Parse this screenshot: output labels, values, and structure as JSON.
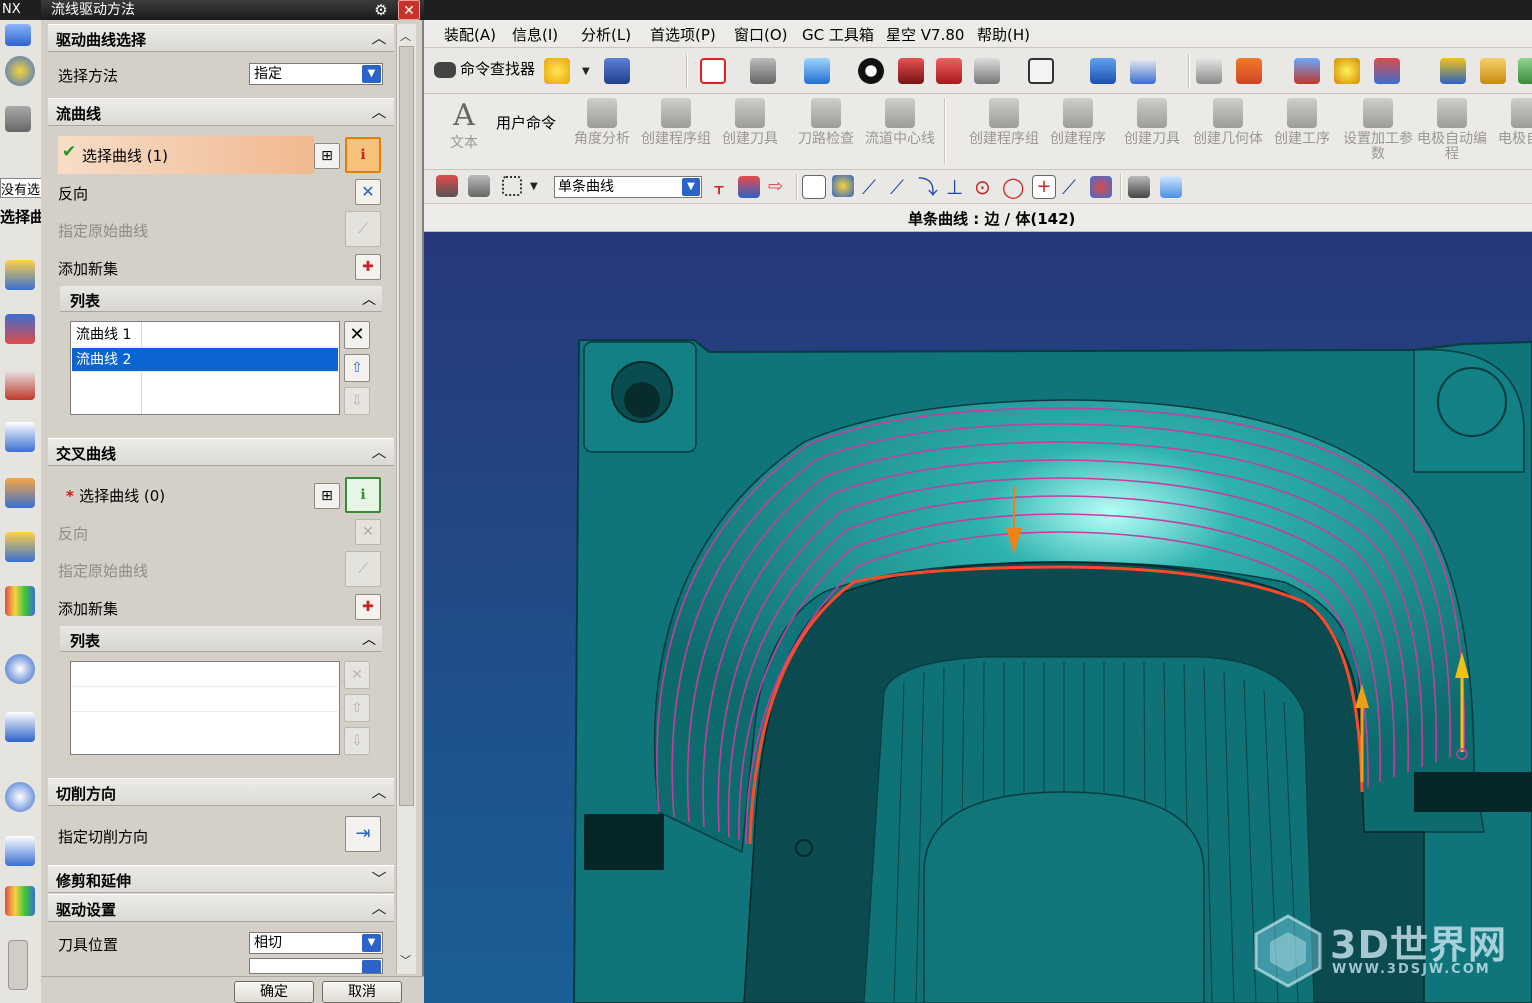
{
  "app": {
    "title_fragment": "NX"
  },
  "menu": [
    {
      "label": "装配(A)"
    },
    {
      "label": "信息(I)"
    },
    {
      "label": "分析(L)"
    },
    {
      "label": "首选项(P)"
    },
    {
      "label": "窗口(O)"
    },
    {
      "label": "GC 工具箱"
    },
    {
      "label": "星空 V7.80"
    },
    {
      "label": "帮助(H)"
    }
  ],
  "toolbar1": {
    "command_finder": "命令查找器"
  },
  "toolbar2": {
    "text_label": "文本",
    "user_cmd": "用户命令",
    "items": [
      {
        "label": "角度分析",
        "icon": "angle-analysis-icon"
      },
      {
        "label": "创建程序组",
        "icon": "create-program-group-icon"
      },
      {
        "label": "创建刀具",
        "icon": "create-tool-icon"
      },
      {
        "label": "刀路检查",
        "icon": "toolpath-check-icon"
      },
      {
        "label": "流道中心线",
        "icon": "runner-centerline-icon"
      },
      {
        "label": "创建程序组",
        "icon": "create-program-group-icon"
      },
      {
        "label": "创建程序",
        "icon": "create-program-icon"
      },
      {
        "label": "创建刀具",
        "icon": "create-tool-icon"
      },
      {
        "label": "创建几何体",
        "icon": "create-geometry-icon"
      },
      {
        "label": "创建工序",
        "icon": "create-operation-icon"
      },
      {
        "label": "设置加工参数",
        "icon": "set-machining-params-icon"
      },
      {
        "label": "电极自动编程",
        "icon": "electrode-auto-program-icon"
      },
      {
        "label": "电极自动",
        "icon": "electrode-auto-icon"
      }
    ]
  },
  "selection_bar": {
    "filter": "单条曲线"
  },
  "status": {
    "text": "单条曲线 : 边 / 体(142)"
  },
  "left_resource": {
    "frag1": "没有选",
    "frag2": "选择曲"
  },
  "dialog": {
    "title": "流线驱动方法",
    "sections": {
      "drive_select": "驱动曲线选择",
      "flow": "流曲线",
      "cross": "交叉曲线",
      "cut_dir": "切削方向",
      "trim": "修剪和延伸",
      "drive_settings": "驱动设置"
    },
    "select_method_label": "选择方法",
    "select_method_value": "指定",
    "flow": {
      "select_curve": "选择曲线 (1)",
      "reverse": "反向",
      "origin_curve": "指定原始曲线",
      "add_set": "添加新集",
      "list_title": "列表",
      "list": [
        "流曲线 1",
        "流曲线 2"
      ]
    },
    "cross": {
      "select_curve": "选择曲线 (0)",
      "reverse": "反向",
      "origin_curve": "指定原始曲线",
      "add_set": "添加新集",
      "list_title": "列表"
    },
    "cut_dir_label": "指定切削方向",
    "tool_pos_label": "刀具位置",
    "tool_pos_value": "相切",
    "ok": "确定",
    "cancel": "取消"
  },
  "watermark": {
    "big": "3D世界网",
    "small": "WWW.3DSJW.COM"
  },
  "colors": {
    "model_teal": "#0e7d7d",
    "background_blue": "#1c3a7a",
    "flow_line": "#c040a0",
    "selected_curve": "#ff4a2a",
    "list_selection": "#0a64d2"
  }
}
